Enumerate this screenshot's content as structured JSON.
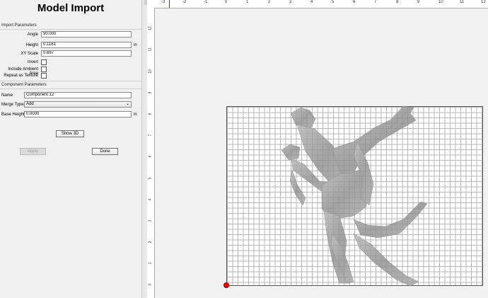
{
  "window": {
    "title": "Model Import"
  },
  "import_parameters": {
    "section_label": "Import Parameters",
    "angle": {
      "label": "Angle",
      "value": "90.000"
    },
    "height": {
      "label": "Height",
      "value": "0.1181",
      "unit": "in"
    },
    "xy_scale": {
      "label": "XY Scale",
      "value": "0.697"
    },
    "invert": {
      "label": "Invert",
      "checked": false
    },
    "include_ambient": {
      "label": "Include Ambient Area",
      "checked": false
    },
    "repeat_texture": {
      "label": "Repeat as Texture",
      "checked": false
    }
  },
  "component_parameters": {
    "section_label": "Component Parameters",
    "name": {
      "label": "Name",
      "value": "Component 12"
    },
    "merge_type": {
      "label": "Merge Type",
      "value": "Add"
    },
    "base_height": {
      "label": "Base Height",
      "value": "0.0000",
      "unit": "in"
    }
  },
  "buttons": {
    "show3d": "Show 3D",
    "apply": "Apply",
    "done": "Done"
  },
  "rulers": {
    "top": [
      "-3",
      "-2",
      "-1",
      "0",
      "1",
      "2",
      "3",
      "4",
      "5",
      "6",
      "7",
      "8",
      "9",
      "10",
      "11",
      "12"
    ],
    "left": [
      "12",
      "11",
      "10",
      "9",
      "8",
      "7",
      "6",
      "5",
      "4",
      "3",
      "2",
      "1",
      "0"
    ]
  },
  "colors": {
    "panel": "#f0f0f0",
    "grid_line": "#b7b7b7",
    "origin": "#e00000",
    "model": "#9a9a9a"
  },
  "icons": {
    "merge_dropdown": "chevron-down-icon",
    "origin_marker": "origin-dot-icon"
  }
}
